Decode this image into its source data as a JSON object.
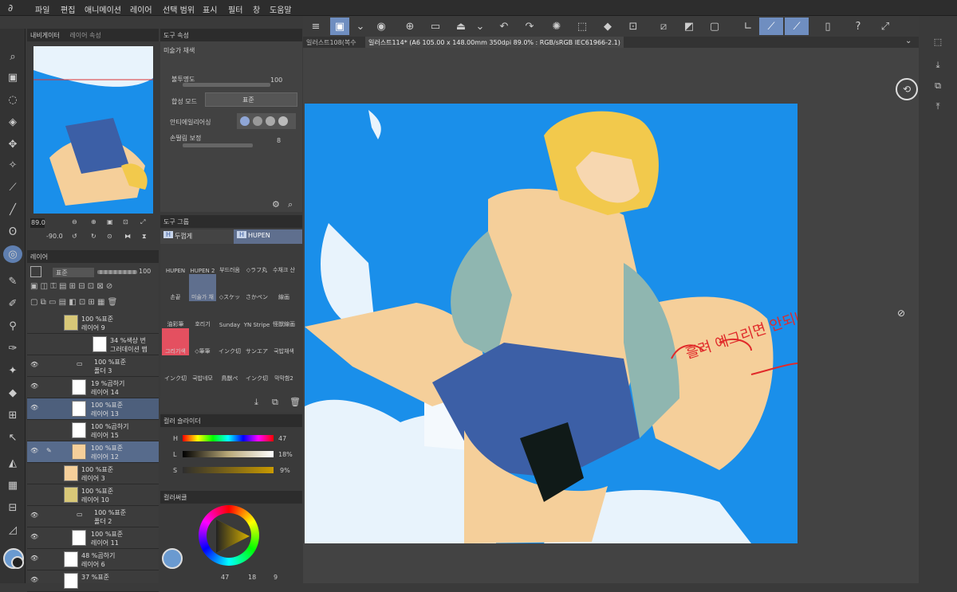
{
  "menu": [
    "파일",
    "편집",
    "애니메이션",
    "레이어",
    "선택 범위",
    "표시",
    "필터",
    "창",
    "도움말"
  ],
  "doc_tabs": [
    "일러스트108(복수",
    "일러스트114* (A6 105.00 x 148.00mm 350dpi 89.0% : RGB/sRGB IEC61966-2.1)"
  ],
  "navigator": {
    "tabs": [
      "내비게이터",
      "레이어 속성"
    ],
    "zoom": "89.0",
    "rotation": "-90.0"
  },
  "tool_property": {
    "tab": "도구 속성",
    "brush_name": "미술가 채색",
    "opacity_label": "불투명도",
    "opacity_value": "100",
    "blend_label": "합성 모드",
    "blend_value": "표준",
    "aa_label": "안티에일리어싱",
    "stab_label": "손떨림 보정",
    "stab_value": "8"
  },
  "subtool": {
    "tab": "도구 그룹",
    "groups": [
      "두껍게",
      "HUPEN"
    ],
    "brushes": [
      "HUPEN",
      "HUPEN 2",
      "부드러움",
      "◇ラフ丸",
      "수채크 산",
      "손끝",
      "미술가 채",
      "◇スケッ",
      "さかペン",
      "線画",
      "油彩筆",
      "호리기",
      "Sunday",
      "YN Stripe",
      "怪獣線画",
      "그리기색",
      "◇筆筆",
      "インク切",
      "サンエア",
      "국밥채색",
      "インク切",
      "국밥네모",
      "鳥獣ペ",
      "インク切",
      "막막함2"
    ]
  },
  "layers": {
    "tab": "레이어",
    "blend": "표준",
    "opacity": "100",
    "items": [
      {
        "pct": "100 %표준",
        "name": "레이어 9"
      },
      {
        "pct": "34 %색상 번",
        "name": "그러데이션 맵"
      },
      {
        "pct": "100 %표준",
        "name": "폴더 3"
      },
      {
        "pct": "19 %곱하기",
        "name": "레이어 14"
      },
      {
        "pct": "100 %표준",
        "name": "레이어 13"
      },
      {
        "pct": "100 %곱하기",
        "name": "레이어 15"
      },
      {
        "pct": "100 %표준",
        "name": "레이어 12"
      },
      {
        "pct": "100 %표준",
        "name": "레이어 3"
      },
      {
        "pct": "100 %표준",
        "name": "레이어 10"
      },
      {
        "pct": "100 %표준",
        "name": "폴더 2"
      },
      {
        "pct": "100 %표준",
        "name": "레이어 11"
      },
      {
        "pct": "48 %곱하기",
        "name": "레이어 6"
      },
      {
        "pct": "37 %표준",
        "name": ""
      }
    ]
  },
  "color_slider": {
    "tab": "컬러 슬라이더",
    "h": "47",
    "l": "18%",
    "s": "9%"
  },
  "color_wheel": {
    "tab": "컬러써클",
    "h": "47",
    "l": "18",
    "s": "9"
  },
  "canvas_text": "흘려 예그리면 안되나~",
  "colors": {
    "sky": "#1a8fea",
    "skin": "#f5cf9a",
    "hair": "#f2c94c",
    "accent": "#6f8ec0",
    "handwriting": "#e02a2a"
  }
}
